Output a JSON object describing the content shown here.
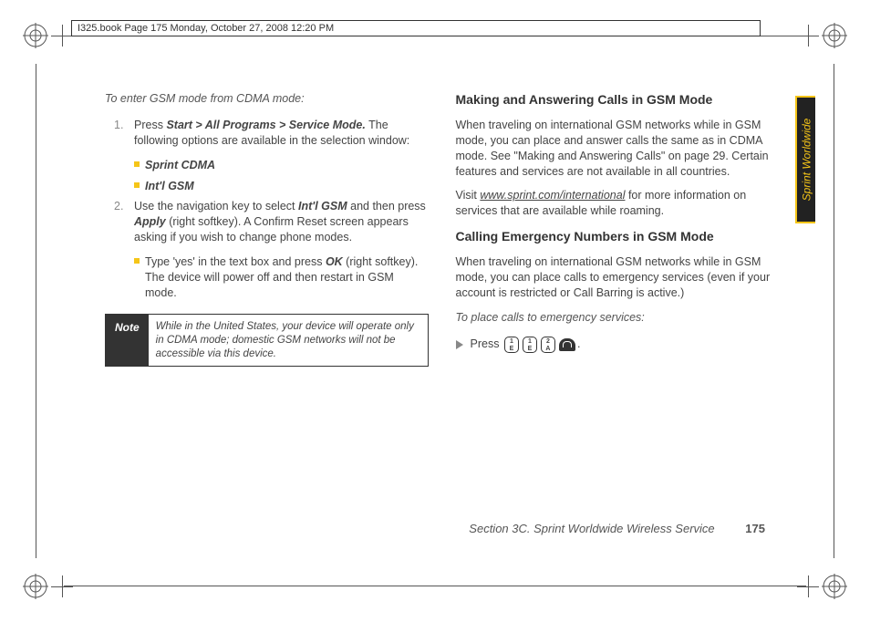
{
  "header": {
    "text": "I325.book  Page 175  Monday, October 27, 2008  12:20 PM"
  },
  "left_col": {
    "heading": "To enter GSM mode from CDMA mode:",
    "step1_num": "1.",
    "step1_text_a": "Press ",
    "step1_start": "Start",
    "step1_gt1": " > ",
    "step1_allprograms": "All Programs",
    "step1_gt2": " > ",
    "step1_servicemode": "Service Mode.",
    "step1_text_b": " The following options are available in the selection window:",
    "bullet1": "Sprint CDMA",
    "bullet2": "Int'l GSM",
    "step2_num": "2.",
    "step2_text_a": "Use the navigation key to select ",
    "step2_intlgsm": "Int'l GSM",
    "step2_text_b": " and then press ",
    "step2_apply": "Apply",
    "step2_text_c": " (right softkey). A Confirm Reset screen appears asking if you wish to change phone modes.",
    "bullet3_a": "Type 'yes' in the text box and press ",
    "bullet3_ok": "OK",
    "bullet3_b": " (right softkey). The device will power off and then restart in GSM mode.",
    "note_label": "Note",
    "note_text": "While in the United States, your device will operate only in CDMA mode; domestic GSM networks will not be accessible via this device."
  },
  "right_col": {
    "heading1": "Making and Answering Calls in GSM Mode",
    "para1": "When traveling on international GSM networks while in GSM mode, you can place and answer calls the same as in CDMA mode. See \"Making and Answering Calls\" on page 29. Certain features and services are not available in all countries.",
    "para2_a": "Visit ",
    "para2_link": "www.sprint.com/international",
    "para2_b": " for more information on services that are available while roaming.",
    "heading2": "Calling Emergency Numbers in GSM Mode",
    "para3": "When traveling on international GSM networks while in GSM mode, you can place calls to emergency services (even if your account is restricted or Call Barring is active.)",
    "instruction": "To place calls to emergency services:",
    "press_label": "Press",
    "key1_top": "1",
    "key1_bot": "E",
    "key2_top": "1",
    "key2_bot": "E",
    "key3_top": "2",
    "key3_bot": "A",
    "period": "."
  },
  "side_tab": "Sprint Worldwide",
  "footer": {
    "section": "Section 3C. Sprint Worldwide Wireless Service",
    "page": "175"
  }
}
